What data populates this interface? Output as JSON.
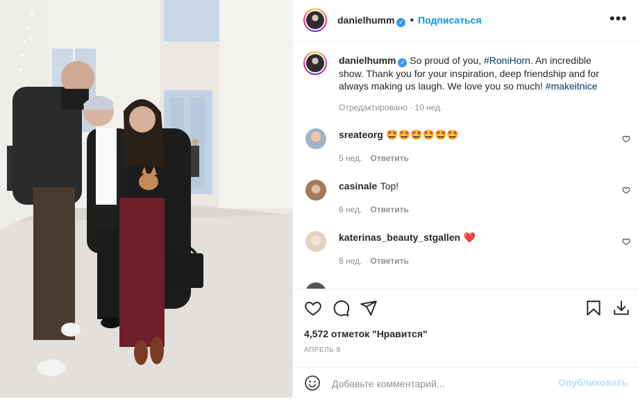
{
  "header": {
    "username": "danielhumm",
    "follow_label": "Подписаться",
    "more_icon": "more-options-icon"
  },
  "caption": {
    "username": "danielhumm",
    "text_1": " So proud of you, ",
    "mention": "#RoniHorn",
    "text_2": ". An incredible show. Thank you for your inspiration, deep friendship and for always making us laugh. We love you so much! ",
    "hashtag": "#makeitnice",
    "edited": "Отредактировано",
    "time": "10 нед."
  },
  "comments": [
    {
      "username": "sreateorg",
      "text": "🤩🤩🤩🤩🤩🤩",
      "time": "5 нед.",
      "reply": "Ответить"
    },
    {
      "username": "casinale",
      "text": "Top!",
      "time": "6 нед.",
      "reply": "Ответить"
    },
    {
      "username": "katerinas_beauty_stgallen",
      "text": "❤️",
      "time": "8 нед.",
      "reply": "Ответить"
    }
  ],
  "actions": {
    "likes": "4,572 отметок \"Нравится\"",
    "date": "АПРЕЛЬ 8"
  },
  "add_comment": {
    "placeholder": "Добавьте комментарий...",
    "publish_label": "Опубликовать"
  },
  "colors": {
    "accent": "#0095f6",
    "link": "#00376b",
    "muted": "#8e8e8e",
    "heart_red": "#ed4956"
  }
}
